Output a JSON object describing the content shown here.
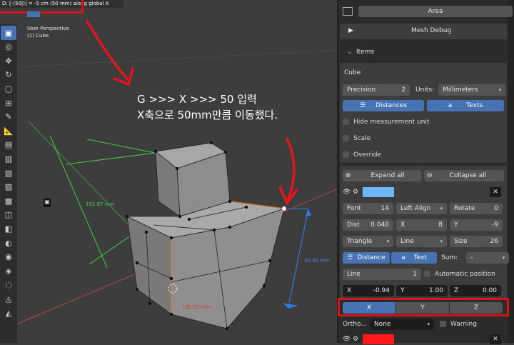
{
  "viewport": {
    "header_text": "D: [-(50|)] = -5 cm (50 mm) along global X",
    "perspective": "User Perspective",
    "object": "(1) Cube",
    "annotation_line1": "G >>> X >>> 50 입력",
    "annotation_line2": "X축으로 50mm만큼 이동했다.",
    "dim_green": "191.87 mm",
    "dim_red": "191.87 mm",
    "dim_blue": "50.00 mm"
  },
  "toolbar": [
    "select-box-icon",
    "cursor-icon",
    "move-icon",
    "rotate-icon",
    "scale-icon",
    "transform-icon",
    "annotate-icon",
    "measure-icon",
    "add-cube-icon",
    "extrude-icon",
    "inset-icon",
    "bevel-icon",
    "loop-cut-icon",
    "knife-icon",
    "poly-build-icon",
    "spin-icon",
    "smooth-icon",
    "edge-slide-icon",
    "shrink-fatten-icon",
    "shear-icon",
    "rip-icon"
  ],
  "panel": {
    "area_label": "Area",
    "mesh_debug_label": "Mesh Debug",
    "items_label": "Items",
    "object_name": "Cube",
    "precision_label": "Precision",
    "precision_value": "2",
    "units_label": "Units:",
    "units_value": "Millimeters",
    "distances_label": "Distances",
    "texts_label": "Texts",
    "hide_unit_label": "Hide measurement unit",
    "scale_label": "Scale",
    "override_label": "Override",
    "expand_all": "Expand all",
    "collapse_all": "Collapse all",
    "swatch_color_1": "#6cb6f4",
    "font_label": "Font",
    "font_value": "14",
    "align_value": "Left Align",
    "rotate_label": "Rotate",
    "rotate_value": "0",
    "dist_label": "Dist",
    "dist_value": "0.040",
    "x_label": "X",
    "x_value": "8",
    "y_label": "Y",
    "y_value": "-9",
    "arrow_value": "Triangle",
    "line_style_value": "Line",
    "size_label": "Size",
    "size_value": "26",
    "distance_label": "Distance",
    "text_label": "Text",
    "sum_label": "Sum:",
    "sum_value": "-",
    "line_label": "Line",
    "line_value": "1",
    "auto_pos_label": "Automatic position",
    "px_label": "X",
    "px_value": "-0.94",
    "py_label": "Y",
    "py_value": "1.00",
    "pz_label": "Z",
    "pz_value": "0.00",
    "axis_x": "X",
    "axis_y": "Y",
    "axis_z": "Z",
    "ortho_label": "Ortho...",
    "ortho_value": "None",
    "warning_label": "Warning",
    "swatch_color_2": "#ff1a1a"
  }
}
